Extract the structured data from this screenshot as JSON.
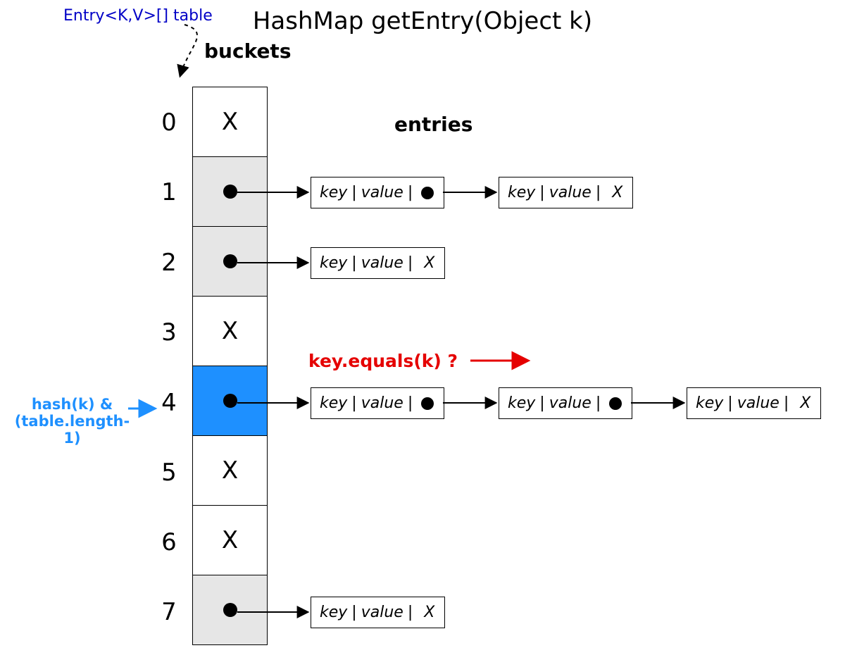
{
  "title": "HashMap getEntry(Object k)",
  "table_label": "Entry<K,V>[] table",
  "buckets_label": "buckets",
  "entries_label": "entries",
  "hash_line1": "hash(k) &",
  "hash_line2": "(table.length-1)",
  "key_equals": "key.equals(k) ?",
  "indices": [
    "0",
    "1",
    "2",
    "3",
    "4",
    "5",
    "6",
    "7"
  ],
  "null_mark": "X",
  "entry_key": "key",
  "entry_value": "value",
  "bar": "|",
  "buckets": [
    {
      "index": 0,
      "state": "null",
      "color": "white"
    },
    {
      "index": 1,
      "state": "ptr",
      "color": "gray",
      "chain": [
        "ptr",
        "null"
      ]
    },
    {
      "index": 2,
      "state": "ptr",
      "color": "gray",
      "chain": [
        "null"
      ]
    },
    {
      "index": 3,
      "state": "null",
      "color": "white"
    },
    {
      "index": 4,
      "state": "ptr",
      "color": "blue",
      "chain": [
        "ptr",
        "ptr",
        "null"
      ],
      "highlighted": true
    },
    {
      "index": 5,
      "state": "null",
      "color": "white"
    },
    {
      "index": 6,
      "state": "null",
      "color": "white"
    },
    {
      "index": 7,
      "state": "ptr",
      "color": "gray",
      "chain": [
        "null"
      ]
    }
  ]
}
